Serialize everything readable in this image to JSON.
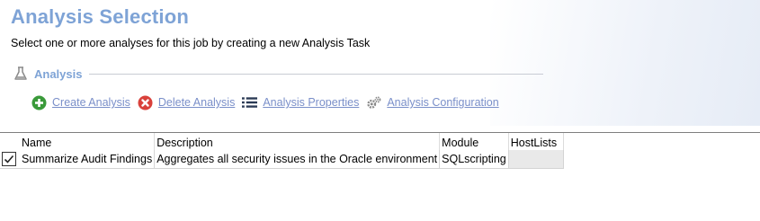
{
  "header": {
    "title": "Analysis Selection",
    "subtitle": "Select one or more analyses for this job by creating a new Analysis Task"
  },
  "section": {
    "label": "Analysis",
    "icon": "flask-icon"
  },
  "toolbar": {
    "actions": [
      {
        "label": "Create Analysis",
        "icon": "plus-circle-icon",
        "color": "#3a9a3a"
      },
      {
        "label": "Delete Analysis",
        "icon": "x-circle-icon",
        "color": "#d9413b"
      },
      {
        "label": "Analysis Properties",
        "icon": "list-icon",
        "color": "#2b3a55"
      },
      {
        "label": "Analysis Configuration",
        "icon": "gears-icon",
        "color": "#8a8a8a"
      }
    ]
  },
  "table": {
    "columns": [
      "Name",
      "Description",
      "Module",
      "HostLists"
    ],
    "rows": [
      {
        "checked": true,
        "name": "Summarize Audit Findings",
        "description": "Aggregates all security issues in the Oracle environment",
        "module": "SQLscripting",
        "hostlists": ""
      }
    ]
  },
  "colors": {
    "title": "#7ea3d6",
    "link": "#7a8fc9"
  }
}
